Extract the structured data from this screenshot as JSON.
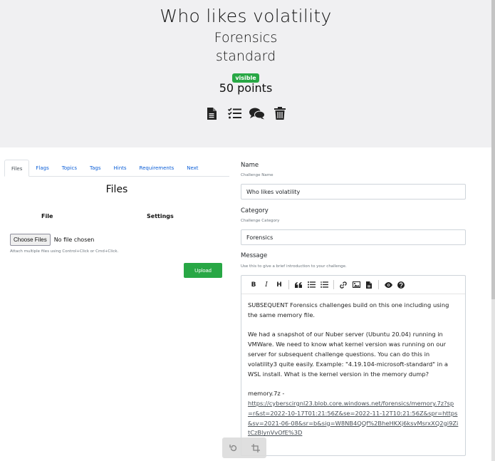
{
  "challenge": {
    "name": "Who likes volatility",
    "category": "Forensics",
    "type": "standard",
    "state_badge": "visible",
    "points": "50 points"
  },
  "header_icons": [
    "file-icon",
    "list-check-icon",
    "comments-icon",
    "trash-icon"
  ],
  "tabs": [
    {
      "label": "Files",
      "active": true
    },
    {
      "label": "Flags"
    },
    {
      "label": "Topics"
    },
    {
      "label": "Tags"
    },
    {
      "label": "Hints"
    },
    {
      "label": "Requirements"
    },
    {
      "label": "Next"
    }
  ],
  "files_panel": {
    "title": "Files",
    "col_file": "File",
    "col_settings": "Settings",
    "choose_label": "Choose Files",
    "no_file_label": "No file chosen",
    "hint": "Attach multiple files using Control+Click or Cmd+Click.",
    "upload_label": "Upload"
  },
  "form": {
    "name_label": "Name",
    "name_sublabel": "Challenge Name",
    "name_value": "Who likes volatility",
    "category_label": "Category",
    "category_sublabel": "Challenge Category",
    "category_value": "Forensics",
    "message_label": "Message",
    "message_sublabel": "Use this to give a brief introduction to your challenge."
  },
  "editor": {
    "toolbar": [
      "B",
      "I",
      "H",
      "quote-icon",
      "unordered-list-icon",
      "ordered-list-icon",
      "link-icon",
      "image-icon",
      "file-icon",
      "preview-icon",
      "help-icon"
    ],
    "para1": "SUBSEQUENT Forensics challenges build on this one including using the same memory file.",
    "para2": "We had a snapshot of our Nuber server (Ubuntu 20.04) running in VMWare.  We need to know what kernel version was running on our server for subsequent challenge questions.  You can do this in volatility3 quite easily. Example: \"4.19.104-microsoft-standard\" in a WSL install.  What is the kernel version in the memory dump?",
    "link_prefix": "memory.7z -",
    "link_url": "https://cyberscirgnl23.blob.core.windows.net/forensics/memory.7z?sp=r&st=2022-10-17T01:21:56Z&se=2022-11-12T10:21:56Z&spr=https&sv=2021-06-08&sr=b&sig=W8NB4QQf%2BheHKXj6ksvMsrxXQ2gi9ZitCzBlynVvOfE%3D"
  },
  "colors": {
    "hero_bg": "#f0f0f2",
    "success": "#28a745",
    "tab_link": "#0b5ed7"
  }
}
